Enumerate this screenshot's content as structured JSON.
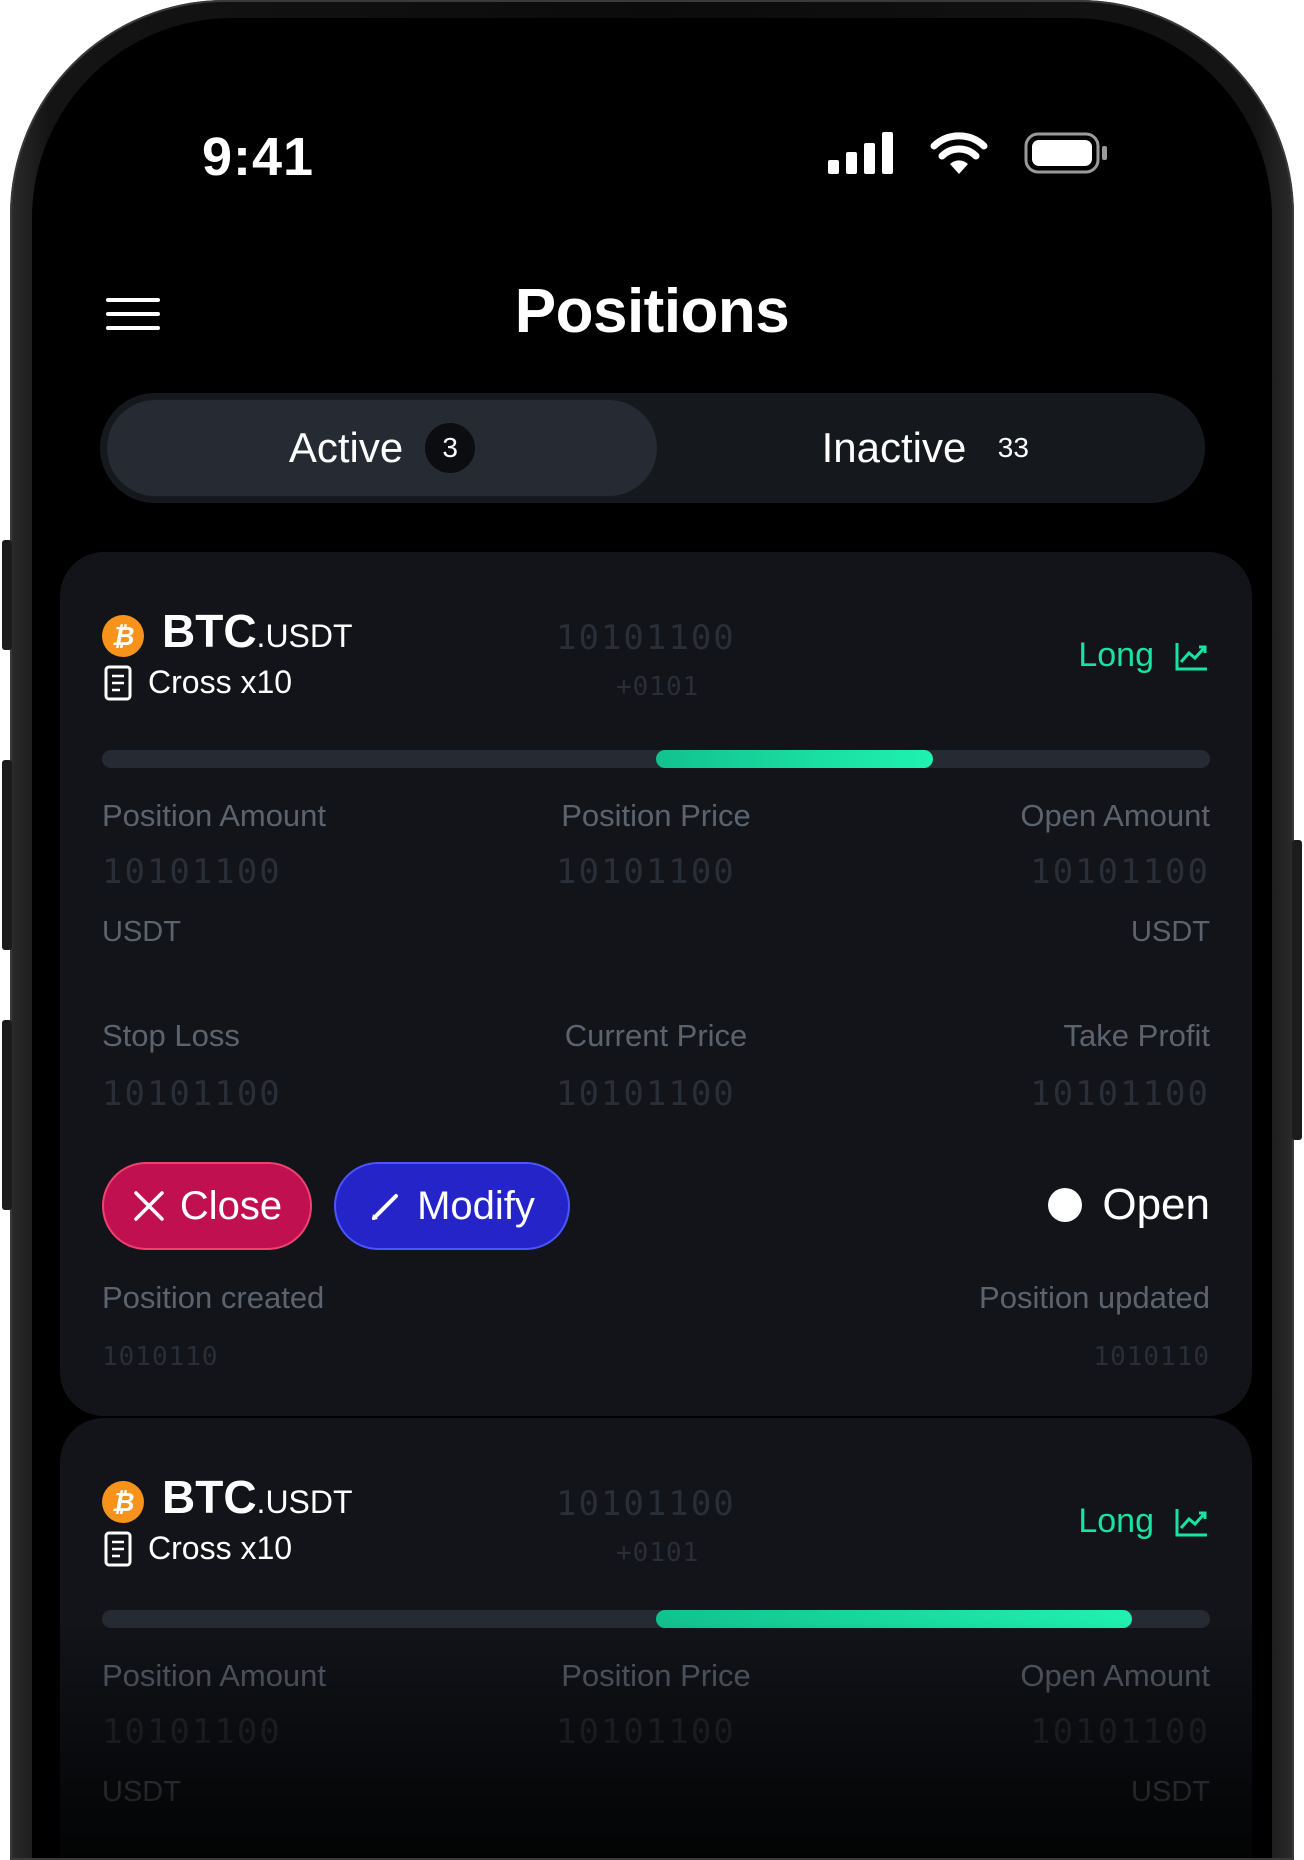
{
  "status_bar": {
    "time": "9:41"
  },
  "header": {
    "title": "Positions",
    "menu_icon": "hamburger-menu-icon"
  },
  "tabs": [
    {
      "label": "Active",
      "count": "3",
      "selected": true
    },
    {
      "label": "Inactive",
      "count": "33",
      "selected": false
    }
  ],
  "positions": [
    {
      "base": "BTC",
      "quote": ".USDT",
      "coin_icon": "bitcoin-icon",
      "coin_symbol": "₿",
      "margin": "Cross x10",
      "masked_value": "10101100",
      "masked_change": "+0101",
      "side": "Long",
      "side_icon": "trend-up-icon",
      "progress": {
        "start": 0.5,
        "end": 0.75
      },
      "fields": {
        "position_amount": {
          "label": "Position Amount",
          "value": "10101100",
          "unit": "USDT"
        },
        "position_price": {
          "label": "Position Price",
          "value": "10101100"
        },
        "open_amount": {
          "label": "Open Amount",
          "value": "10101100",
          "unit": "USDT"
        },
        "stop_loss": {
          "label": "Stop Loss",
          "value": "10101100"
        },
        "current_price": {
          "label": "Current Price",
          "value": "10101100"
        },
        "take_profit": {
          "label": "Take Profit",
          "value": "10101100"
        }
      },
      "actions": {
        "close": "Close",
        "modify": "Modify"
      },
      "status": "Open",
      "created": {
        "label": "Position created",
        "value": "1010110"
      },
      "updated": {
        "label": "Position updated",
        "value": "1010110"
      }
    },
    {
      "base": "BTC",
      "quote": ".USDT",
      "coin_icon": "bitcoin-icon",
      "coin_symbol": "₿",
      "margin": "Cross x10",
      "masked_value": "10101100",
      "masked_change": "+0101",
      "side": "Long",
      "side_icon": "trend-up-icon",
      "progress": {
        "start": 0.5,
        "end": 0.93
      },
      "fields": {
        "position_amount": {
          "label": "Position Amount",
          "value": "10101100",
          "unit": "USDT"
        },
        "position_price": {
          "label": "Position Price",
          "value": "10101100"
        },
        "open_amount": {
          "label": "Open Amount",
          "value": "10101100",
          "unit": "USDT"
        }
      }
    }
  ],
  "colors": {
    "background": "#000000",
    "card": "#12141a",
    "accent_long": "#19e3a0",
    "close_button": "#c0104f",
    "modify_button": "#2424c8",
    "muted_text": "#5d636d"
  }
}
